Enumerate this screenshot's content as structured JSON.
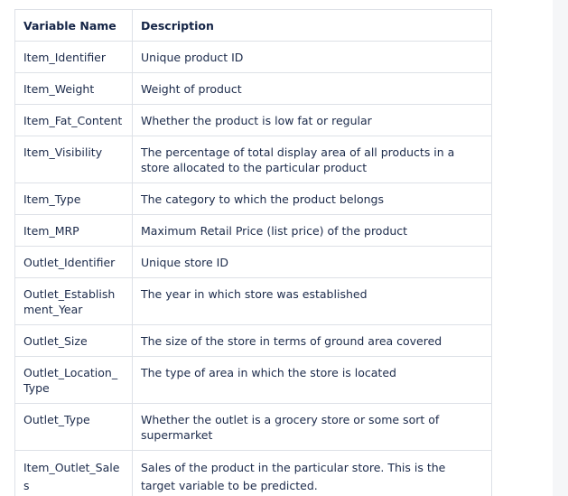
{
  "table": {
    "headers": [
      "Variable Name",
      "Description"
    ],
    "rows": [
      {
        "name": "Item_Identifier",
        "description": "Unique product ID"
      },
      {
        "name": "Item_Weight",
        "description": "Weight of product"
      },
      {
        "name": "Item_Fat_Content",
        "description": "Whether the product is low fat or regular"
      },
      {
        "name": "Item_Visibility",
        "description": "The percentage of total display area of all products in a store allocated to the particular product"
      },
      {
        "name": "Item_Type",
        "description": "The category to which the product belongs"
      },
      {
        "name": "Item_MRP",
        "description": "Maximum Retail Price (list price) of the product"
      },
      {
        "name": "Outlet_Identifier",
        "description": "Unique store ID"
      },
      {
        "name": "Outlet_Establishment_Year",
        "description": "The year in which store was established"
      },
      {
        "name": "Outlet_Size",
        "description": "The size of the store in terms of ground area covered"
      },
      {
        "name": "Outlet_Location_Type",
        "description": "The type of area in which the store is located"
      },
      {
        "name": "Outlet_Type",
        "description": "Whether the outlet is a grocery store or some sort of supermarket"
      },
      {
        "name": "Item_Outlet_Sales",
        "description": "Sales of the product in the particular store. This is the target variable to be predicted."
      }
    ]
  },
  "colors": {
    "text": "#1b2a4a",
    "border": "#dde1e7"
  }
}
